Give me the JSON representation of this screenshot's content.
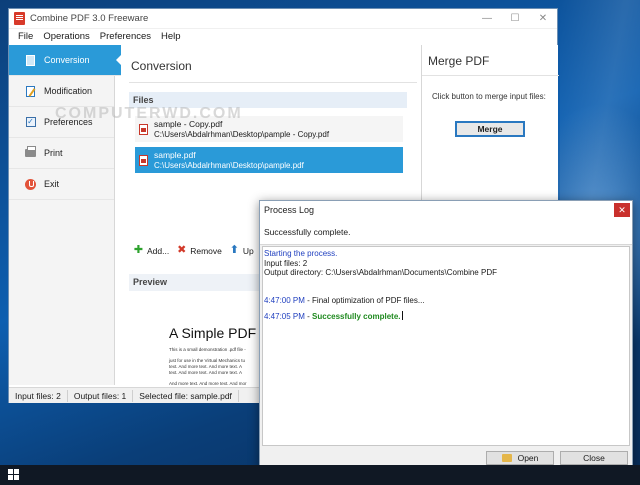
{
  "window": {
    "title": "Combine PDF 3.0 Freeware",
    "controls": {
      "minimize": "—",
      "maximize": "☐",
      "close": "✕"
    }
  },
  "menu": [
    "File",
    "Operations",
    "Preferences",
    "Help"
  ],
  "sidebar": {
    "items": [
      {
        "label": "Conversion",
        "icon": "document-icon",
        "active": true
      },
      {
        "label": "Modification",
        "icon": "edit-document-icon",
        "active": false
      },
      {
        "label": "Preferences",
        "icon": "checkbox-icon",
        "active": false
      },
      {
        "label": "Print",
        "icon": "printer-icon",
        "active": false
      },
      {
        "label": "Exit",
        "icon": "power-icon",
        "active": false
      }
    ]
  },
  "conversion": {
    "title": "Conversion",
    "files_header": "Files",
    "files": [
      {
        "name": "sample - Copy.pdf",
        "path": "C:\\Users\\Abdalrhman\\Desktop\\pample - Copy.pdf",
        "selected": false
      },
      {
        "name": "sample.pdf",
        "path": "C:\\Users\\Abdalrhman\\Desktop\\pample.pdf",
        "selected": true
      }
    ],
    "toolbar": {
      "add": "Add...",
      "remove": "Remove",
      "up": "Up"
    },
    "preview_header": "Preview",
    "preview": {
      "title": "A Simple PDF",
      "lines": [
        "This is a small demonstration .pdf file -",
        "",
        "just for use in the Virtual Mechanics tu",
        "text. And more text. And more text. A",
        "text. And more text. And more text. A",
        "",
        "And more text. And more text. And mor",
        "text. And more text. Boring, zzzzz. And",
        "text. And more text. And more text. A",
        "And more text. And more text. And mor"
      ]
    }
  },
  "watermark": "COMPUTERWD.COM",
  "merge": {
    "title": "Merge PDF",
    "hint": "Click button to merge input files:",
    "button": "Merge"
  },
  "status": {
    "input_files": "Input files: 2",
    "output_files": "Output files: 1",
    "selected_file": "Selected file: sample.pdf"
  },
  "log": {
    "title": "Process Log",
    "close": "✕",
    "status": "Successfully complete.",
    "lines": {
      "start": "Starting the process.",
      "input": "Input files: 2",
      "output": "Output directory: C:\\Users\\Abdalrhman\\Documents\\Combine PDF",
      "t1": "4:47:00 PM",
      "msg1": " - Final optimization of PDF files...",
      "t2": "4:47:05 PM",
      "dash": " - ",
      "msg2": "Successfully complete."
    },
    "buttons": {
      "open": "Open",
      "close": "Close"
    }
  }
}
